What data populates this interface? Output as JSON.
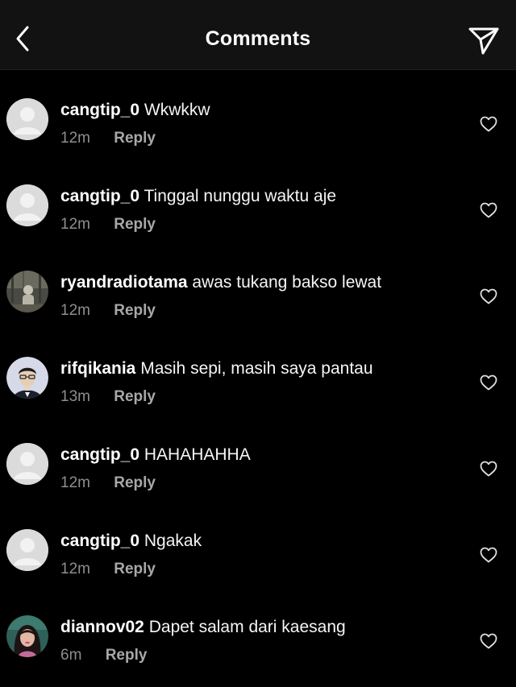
{
  "header": {
    "title": "Comments",
    "back_icon": "chevron-left-icon",
    "send_icon": "paper-plane-icon"
  },
  "colors": {
    "background": "#000000",
    "header_background": "#121212",
    "text": "#ffffff",
    "secondary_text": "#8e8e8e",
    "default_avatar": "#dbdbdb"
  },
  "comments": [
    {
      "username": "cangtip_0",
      "text": "Wkwkkw",
      "time": "12m",
      "reply_label": "Reply",
      "avatar": "default-avatar"
    },
    {
      "username": "cangtip_0",
      "text": "Tinggal nunggu waktu aje",
      "time": "12m",
      "reply_label": "Reply",
      "avatar": "default-avatar"
    },
    {
      "username": "ryandradiotama",
      "text": "awas tukang bakso lewat",
      "time": "12m",
      "reply_label": "Reply",
      "avatar": "photo-avatar"
    },
    {
      "username": "rifqikania",
      "text": "Masih sepi, masih saya pantau",
      "time": "13m",
      "reply_label": "Reply",
      "avatar": "photo-avatar"
    },
    {
      "username": "cangtip_0",
      "text": "HAHAHAHHA",
      "time": "12m",
      "reply_label": "Reply",
      "avatar": "default-avatar"
    },
    {
      "username": "cangtip_0",
      "text": "Ngakak",
      "time": "12m",
      "reply_label": "Reply",
      "avatar": "default-avatar"
    },
    {
      "username": "diannov02",
      "text": "Dapet salam dari kaesang",
      "time": "6m",
      "reply_label": "Reply",
      "avatar": "photo-avatar"
    }
  ]
}
